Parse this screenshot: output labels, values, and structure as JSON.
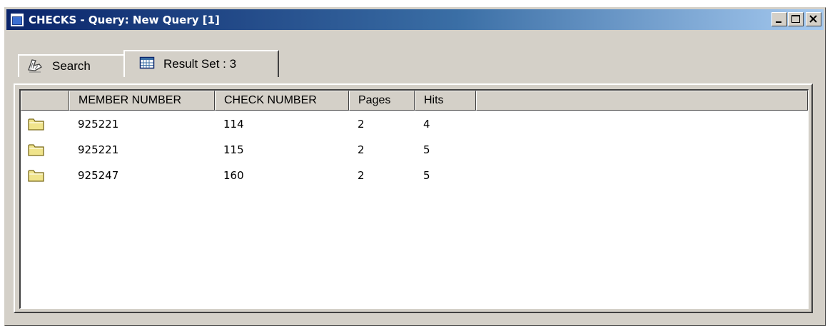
{
  "window": {
    "title": "CHECKS - Query: New Query [1]",
    "buttons": [
      "minimize",
      "maximize",
      "close"
    ]
  },
  "tabs": [
    {
      "label": "Search",
      "icon": "search-icon",
      "active": false
    },
    {
      "label": "Result Set : 3",
      "icon": "table-icon",
      "active": true
    }
  ],
  "table": {
    "columns": [
      "",
      "MEMBER NUMBER",
      "CHECK NUMBER",
      "Pages",
      "Hits",
      ""
    ],
    "rows": [
      {
        "icon": "folder-icon",
        "member_number": "925221",
        "check_number": "114",
        "pages": "2",
        "hits": "4"
      },
      {
        "icon": "folder-icon",
        "member_number": "925221",
        "check_number": "115",
        "pages": "2",
        "hits": "5"
      },
      {
        "icon": "folder-icon",
        "member_number": "925247",
        "check_number": "160",
        "pages": "2",
        "hits": "5"
      }
    ]
  },
  "colors": {
    "titlebar_start": "#0a246a",
    "titlebar_end": "#a6caf0",
    "face": "#d4d0c8",
    "folder": "#f0e48c"
  }
}
